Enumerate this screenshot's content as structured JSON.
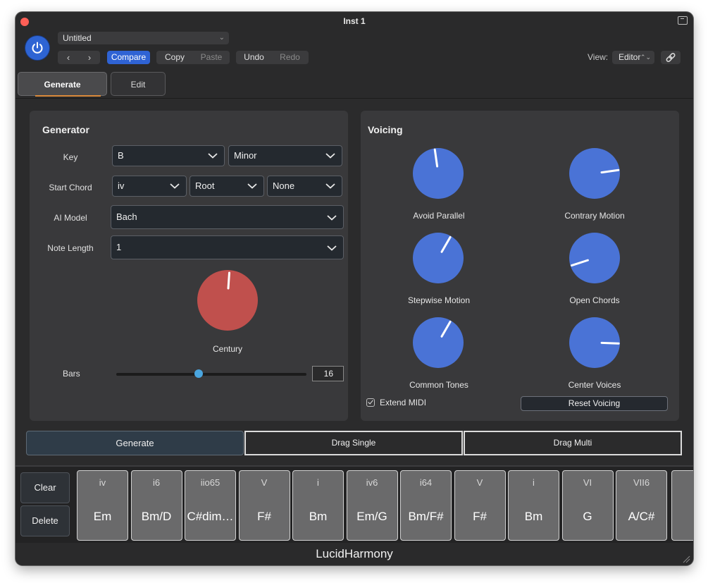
{
  "window": {
    "title": "Inst 1"
  },
  "header": {
    "preset_name": "Untitled",
    "compare_label": "Compare",
    "copy_label": "Copy",
    "paste_label": "Paste",
    "undo_label": "Undo",
    "redo_label": "Redo",
    "view_label": "View:",
    "view_value": "Editor"
  },
  "tabs": [
    {
      "label": "Generate",
      "active": true
    },
    {
      "label": "Edit",
      "active": false
    }
  ],
  "generator": {
    "title": "Generator",
    "key_label": "Key",
    "key_value": "B",
    "scale_value": "Minor",
    "start_chord_label": "Start Chord",
    "start_chord_value": "iv",
    "inversion_value": "Root",
    "extension_value": "None",
    "ai_model_label": "AI Model",
    "ai_model_value": "Bach",
    "note_length_label": "Note Length",
    "note_length_value": "1",
    "century_label": "Century",
    "century_color": "#c0504d",
    "bars_label": "Bars",
    "bars_value": "16",
    "bars_fraction": 0.5
  },
  "voicing": {
    "title": "Voicing",
    "knob_color": "#4a73d6",
    "knobs": [
      {
        "label": "Avoid Parallel",
        "angle_deg": -8
      },
      {
        "label": "Contrary Motion",
        "angle_deg": 82
      },
      {
        "label": "Stepwise Motion",
        "angle_deg": 30
      },
      {
        "label": "Open Chords",
        "angle_deg": -108
      },
      {
        "label": "Common Tones",
        "angle_deg": 30
      },
      {
        "label": "Center Voices",
        "angle_deg": 92
      }
    ],
    "extend_midi_label": "Extend MIDI",
    "extend_midi_checked": true,
    "reset_label": "Reset Voicing"
  },
  "actions": {
    "generate_label": "Generate",
    "drag_single_label": "Drag Single",
    "drag_multi_label": "Drag Multi"
  },
  "strip": {
    "clear_label": "Clear",
    "delete_label": "Delete",
    "chords": [
      {
        "roman": "iv",
        "name": "Em"
      },
      {
        "roman": "i6",
        "name": "Bm/D"
      },
      {
        "roman": "iio65",
        "name": "C#dim…"
      },
      {
        "roman": "V",
        "name": "F#"
      },
      {
        "roman": "i",
        "name": "Bm"
      },
      {
        "roman": "iv6",
        "name": "Em/G"
      },
      {
        "roman": "i64",
        "name": "Bm/F#"
      },
      {
        "roman": "V",
        "name": "F#"
      },
      {
        "roman": "i",
        "name": "Bm"
      },
      {
        "roman": "VI",
        "name": "G"
      },
      {
        "roman": "VII6",
        "name": "A/C#"
      }
    ]
  },
  "footer": {
    "brand": "LucidHarmony"
  }
}
